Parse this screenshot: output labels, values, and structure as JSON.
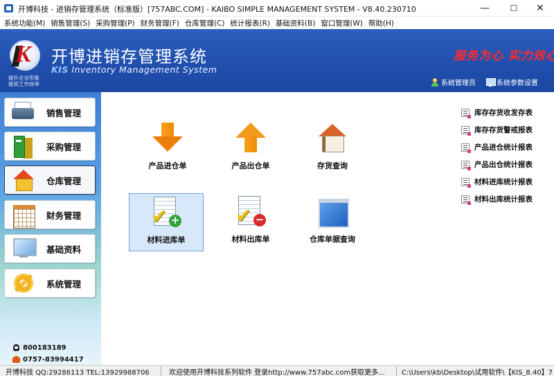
{
  "window": {
    "title": "开博科技 - 进销存管理系统（标准版）[757ABC.COM] - KAIBO SIMPLE MANAGEMENT SYSTEM - V8.40.230710",
    "minimize": "—",
    "maximize": "☐",
    "close": "✕"
  },
  "menu": [
    {
      "label": "系统功能(M)"
    },
    {
      "label": "销售管理(S)"
    },
    {
      "label": "采购管理(P)"
    },
    {
      "label": "财务管理(F)"
    },
    {
      "label": "仓库管理(C)"
    },
    {
      "label": "统计报表(R)"
    },
    {
      "label": "基础资料(B)"
    },
    {
      "label": "窗口管理(W)"
    },
    {
      "label": "帮助(H)"
    }
  ],
  "header": {
    "slogan_line1": "提升企业形象",
    "slogan_line2": "提高工作效率",
    "app_title": "开博进销存管理系统",
    "subtitle_kis": "KIS",
    "subtitle_rest": " Inventory Management System",
    "motto": "服务为心 实力效心",
    "user_button": "系统管理员",
    "settings_button": "系统参数设置"
  },
  "sidebar": {
    "items": [
      {
        "label": "销售管理",
        "icon": "printer-icon"
      },
      {
        "label": "采购管理",
        "icon": "books-icon"
      },
      {
        "label": "仓库管理",
        "icon": "house-icon",
        "active": true
      },
      {
        "label": "财务管理",
        "icon": "calendar-grid-icon"
      },
      {
        "label": "基础资料",
        "icon": "monitor-icon"
      },
      {
        "label": "系统管理",
        "icon": "gear-icon"
      }
    ],
    "contact_qq": "800183189",
    "contact_phone": "0757-83994417"
  },
  "tiles": [
    {
      "label": "产品进仓单",
      "icon": "arrow-down-icon"
    },
    {
      "label": "产品出仓单",
      "icon": "arrow-up-icon"
    },
    {
      "label": "存货查询",
      "icon": "home-icon"
    },
    {
      "label": "材料进库单",
      "icon": "doc-plus-icon",
      "selected": true
    },
    {
      "label": "材料出库单",
      "icon": "doc-minus-icon"
    },
    {
      "label": "仓库单据查询",
      "icon": "window-icon"
    }
  ],
  "reports": [
    {
      "label": "库存存货收发存表"
    },
    {
      "label": "库存存货警戒报表"
    },
    {
      "label": "产品进仓统计报表"
    },
    {
      "label": "产品出仓统计报表"
    },
    {
      "label": "材料进库统计报表"
    },
    {
      "label": "材料出库统计报表"
    }
  ],
  "status": {
    "company": "开博科技 QQ:29286113 TEL:13929988706",
    "welcome": "欢迎使用开博科技系列软件   登录http://www.757abc.com获取更多...",
    "path": "C:\\Users\\kb\\Desktop\\试用软件\\【KIS_8.40】7"
  },
  "colors": {
    "banner": "#214fae",
    "motto": "#ff2a2a",
    "selected_tile": "#d8e8fb"
  }
}
